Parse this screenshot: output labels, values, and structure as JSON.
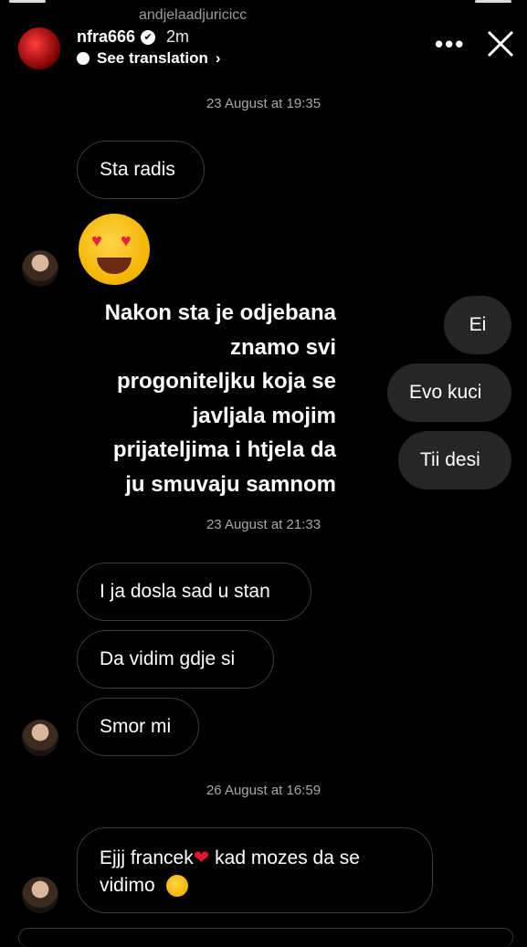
{
  "residue": {
    "username": "andjelaadjuricicc"
  },
  "header": {
    "username": "nfra666",
    "verified_mark": "✔",
    "time_ago": "2m",
    "translate_label": "See translation",
    "translate_chevron": "›",
    "more_icon": "•••",
    "close_icon": "close-icon"
  },
  "timestamps": {
    "first": "23 August at 19:35",
    "second": "23 August at 21:33",
    "third": "26 August at 16:59"
  },
  "messages": {
    "m1": "Sta radis",
    "emoji_reaction": "heart-eyes-emoji",
    "out1": "Ei",
    "out2": "Evo kuci",
    "out3": "Tii desi",
    "m2": "I ja dosla sad u stan",
    "m3": "Da vidim gdje si",
    "m4": "Smor mi",
    "m5_part1": "Ejjj francek",
    "m5_heart": "❤",
    "m5_part2": " kad mozes da se",
    "m5_line2": "vidimo"
  },
  "story_text": {
    "lines": [
      "Nakon sta  je odjebana",
      "znamo svi",
      "progoniteljku koja se",
      "javljala mojim",
      "prijateljima i htjela da",
      "ju smuvaju samnom"
    ]
  }
}
